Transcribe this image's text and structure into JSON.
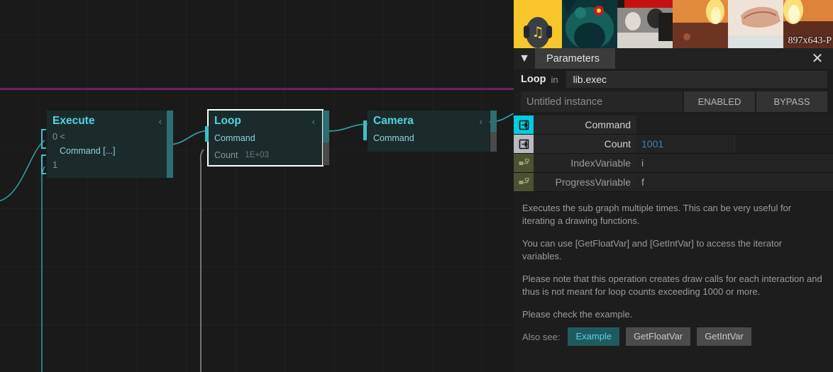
{
  "graph": {
    "nodes": [
      {
        "title": "Execute",
        "chevron": "‹",
        "port_labels": {
          "zero": "0 <",
          "one": "1"
        },
        "rows": [
          {
            "label": "Command [...]"
          }
        ]
      },
      {
        "title": "Loop",
        "chevron": "‹",
        "selected_label": "selected",
        "rows": [
          {
            "label": "Command",
            "value": ""
          },
          {
            "label": "Count",
            "value": "1E+03"
          }
        ]
      },
      {
        "title": "Camera",
        "chevron": "‹",
        "rows": [
          {
            "label": "Command",
            "value": ""
          }
        ]
      }
    ]
  },
  "thumbstrip": {
    "resolution_label": "897x643-P",
    "items": [
      {
        "name": "music-headphones-thumb",
        "bg": "#f7c62a"
      },
      {
        "name": "owl-thumb",
        "bg": "#12403f"
      },
      {
        "name": "bw-photo-thumb",
        "bg": "#b8b4ae"
      },
      {
        "name": "explosion-thumb",
        "bg": "#c4682f"
      },
      {
        "name": "hand-thumb",
        "bg": "#e8d8cd"
      },
      {
        "name": "explosion-two-thumb",
        "bg": "#c4682f"
      }
    ]
  },
  "tabbar": {
    "caret": "▼",
    "active_tab": "Parameters",
    "close": "✕"
  },
  "header": {
    "operator": "Loop",
    "in_word": "in",
    "library": "lib.exec",
    "instance_placeholder": "Untitled instance",
    "enabled_label": "ENABLED",
    "bypass_label": "BYPASS"
  },
  "parameters": [
    {
      "icon": "input-arrow-icon",
      "icon_color": "cyan",
      "label": "Command",
      "value": "",
      "value_type": "none"
    },
    {
      "icon": "input-arrow-icon",
      "icon_color": "gray",
      "label": "Count",
      "value": "1001",
      "value_type": "num"
    },
    {
      "icon": "variable-icon",
      "icon_color": "olive",
      "label": "IndexVariable",
      "value": "i",
      "value_type": "txt"
    },
    {
      "icon": "variable-icon",
      "icon_color": "olive",
      "label": "ProgressVariable",
      "value": "f",
      "value_type": "txt"
    }
  ],
  "description": [
    "Executes the sub graph multiple times. This can be very useful for iterating a drawing functions.",
    "You can use [GetFloatVar] and [GetIntVar] to access the iterator variables.",
    "Please note that this operation creates draw calls for each interaction and thus is not meant for loop counts exceeding 1000 or more.",
    "Please check the example."
  ],
  "also_see": {
    "label": "Also see:",
    "buttons": [
      {
        "label": "Example",
        "active": true
      },
      {
        "label": "GetFloatVar",
        "active": false
      },
      {
        "label": "GetIntVar",
        "active": false
      }
    ]
  },
  "colors": {
    "accent_cyan": "#00ccdf",
    "node_title": "#4fd6e0",
    "magenta_rule": "#6c2061",
    "value_blue": "#3d7fb8",
    "olive_icon": "#4b5132",
    "canvas_bg": "#1a1a1a"
  }
}
